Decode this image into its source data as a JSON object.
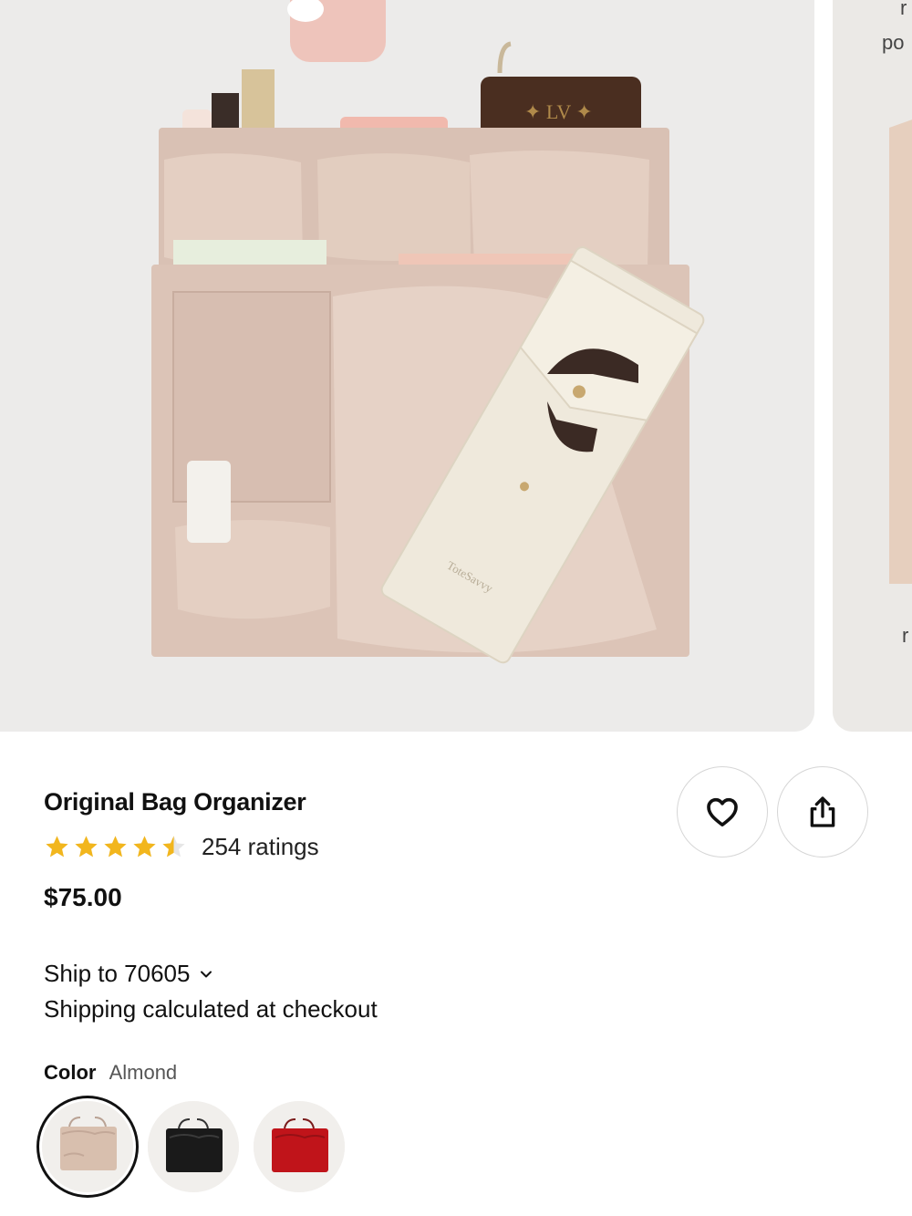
{
  "carousel": {
    "next_peek_text": [
      "r",
      "po",
      "r"
    ]
  },
  "product": {
    "title": "Original Bag Organizer",
    "rating": 4.5,
    "rating_max": 5,
    "ratings_label": "254 ratings",
    "price": "$75.00"
  },
  "shipping": {
    "ship_to_label": "Ship to 70605",
    "note": "Shipping calculated at checkout"
  },
  "color": {
    "label": "Color",
    "selected": "Almond",
    "swatches": [
      {
        "name": "Almond",
        "hex": "#d8bfae",
        "selected": true
      },
      {
        "name": "Black",
        "hex": "#1a1a1a",
        "selected": false
      },
      {
        "name": "Red",
        "hex": "#c0141a",
        "selected": false
      }
    ]
  },
  "icons": {
    "favorite": "heart-icon",
    "share": "share-icon",
    "dropdown": "chevron-down-icon",
    "rating": "star-icon"
  },
  "colors": {
    "star": "#f2b61d",
    "text": "#111111",
    "muted": "#555555",
    "product_photo_bg": "#ecebea"
  }
}
